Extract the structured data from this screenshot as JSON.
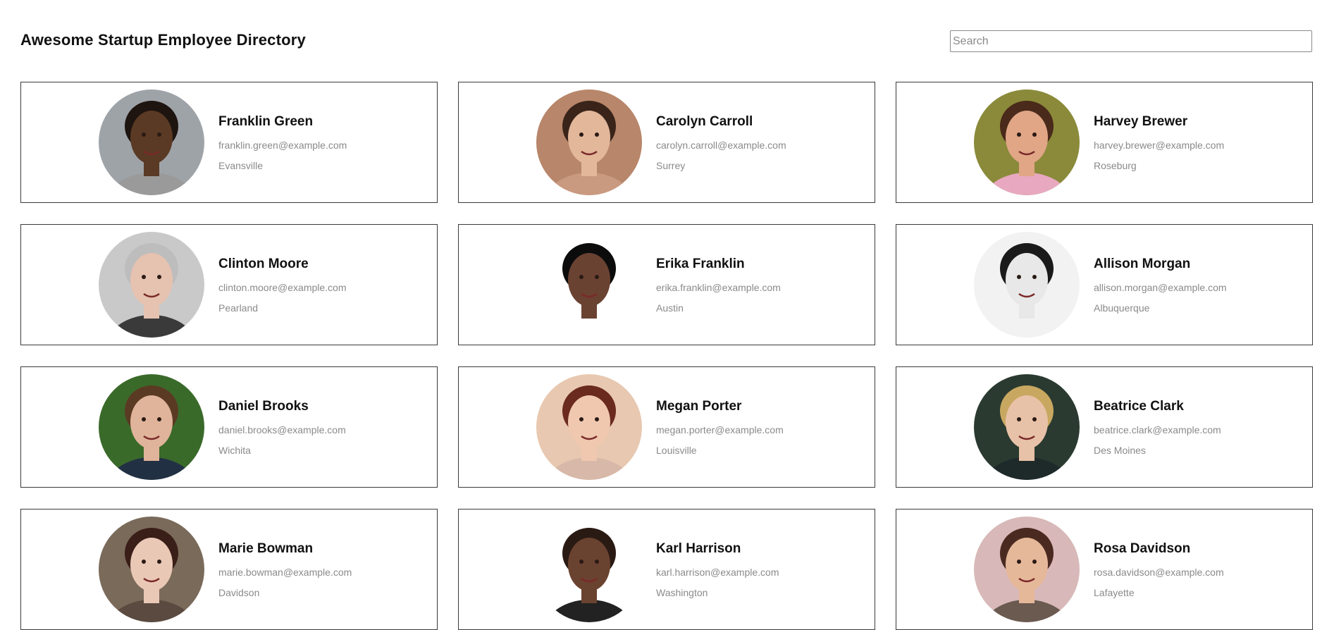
{
  "header": {
    "title": "Awesome Startup Employee Directory",
    "search_placeholder": "Search"
  },
  "employees": [
    {
      "name": "Franklin Green",
      "email": "franklin.green@example.com",
      "city": "Evansville",
      "bg": "#9ea3a8",
      "skin": "#5a3a24",
      "hair": "#1e1410",
      "shirt": "#9a9a9a"
    },
    {
      "name": "Carolyn Carroll",
      "email": "carolyn.carroll@example.com",
      "city": "Surrey",
      "bg": "#b8866a",
      "skin": "#e2b79a",
      "hair": "#3a241a",
      "shirt": "#c99a80"
    },
    {
      "name": "Harvey Brewer",
      "email": "harvey.brewer@example.com",
      "city": "Roseburg",
      "bg": "#8a8a3a",
      "skin": "#e0a686",
      "hair": "#4a2a1a",
      "shirt": "#e8a8c0"
    },
    {
      "name": "Clinton Moore",
      "email": "clinton.moore@example.com",
      "city": "Pearland",
      "bg": "#c9c9c9",
      "skin": "#e6c2b0",
      "hair": "#bdbdbd",
      "shirt": "#3a3a3a"
    },
    {
      "name": "Erika Franklin",
      "email": "erika.franklin@example.com",
      "city": "Austin",
      "bg": "#ffffff",
      "skin": "#6a4232",
      "hair": "#0c0c0c",
      "shirt": "#ffffff"
    },
    {
      "name": "Allison Morgan",
      "email": "allison.morgan@example.com",
      "city": "Albuquerque",
      "bg": "#f2f2f2",
      "skin": "#e8e8e8",
      "hair": "#1a1a1a",
      "shirt": "#f2f2f2"
    },
    {
      "name": "Daniel Brooks",
      "email": "daniel.brooks@example.com",
      "city": "Wichita",
      "bg": "#3a6a2a",
      "skin": "#e0b49a",
      "hair": "#5a3a22",
      "shirt": "#223044"
    },
    {
      "name": "Megan Porter",
      "email": "megan.porter@example.com",
      "city": "Louisville",
      "bg": "#e8c8b0",
      "skin": "#f0c8b0",
      "hair": "#6a2a1e",
      "shirt": "#d8b8a8"
    },
    {
      "name": "Beatrice Clark",
      "email": "beatrice.clark@example.com",
      "city": "Des Moines",
      "bg": "#2a3a30",
      "skin": "#e8c2a8",
      "hair": "#c8a860",
      "shirt": "#1e2a2a"
    },
    {
      "name": "Marie Bowman",
      "email": "marie.bowman@example.com",
      "city": "Davidson",
      "bg": "#7a6a5a",
      "skin": "#eac8b6",
      "hair": "#3a1e18",
      "shirt": "#5a4a40"
    },
    {
      "name": "Karl Harrison",
      "email": "karl.harrison@example.com",
      "city": "Washington",
      "bg": "#ffffff",
      "skin": "#6a4230",
      "hair": "#2a1a14",
      "shirt": "#222222"
    },
    {
      "name": "Rosa Davidson",
      "email": "rosa.davidson@example.com",
      "city": "Lafayette",
      "bg": "#d8b8b8",
      "skin": "#e6b89a",
      "hair": "#4a2a20",
      "shirt": "#6a5a50"
    }
  ]
}
